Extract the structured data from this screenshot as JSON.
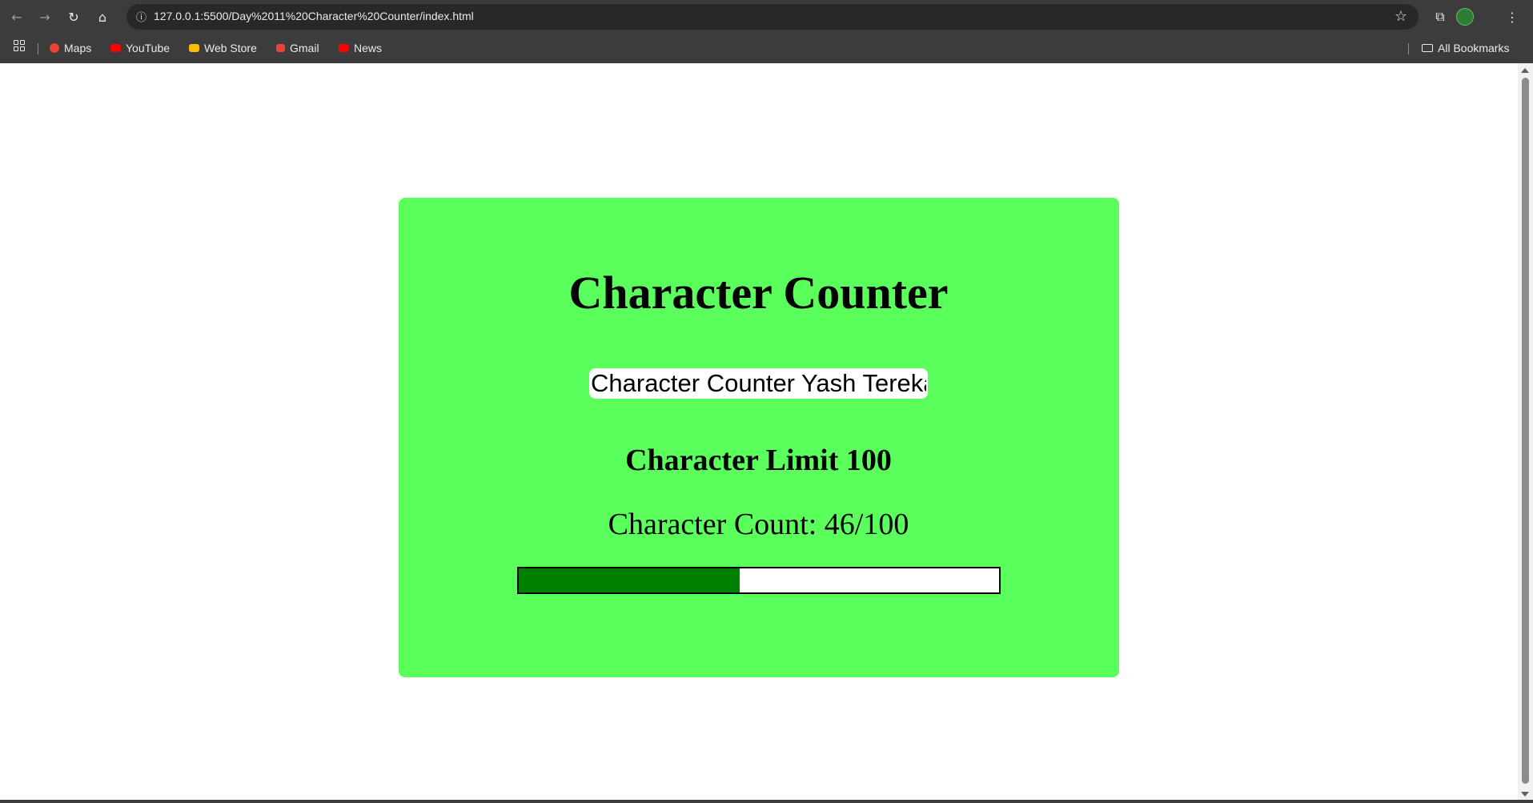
{
  "browser": {
    "url": "127.0.0.1:5500/Day%2011%20Character%20Counter/index.html",
    "bookmarks": [
      {
        "label": "Maps",
        "color": "#ea4335"
      },
      {
        "label": "YouTube",
        "color": "#ff0000"
      },
      {
        "label": "Web Store",
        "color": "#fbbc04"
      },
      {
        "label": "Gmail",
        "color": "#ea4335"
      },
      {
        "label": "News",
        "color": "#ff0000"
      }
    ],
    "all_bookmarks_label": "All Bookmarks",
    "icons": {
      "back": "back-arrow-icon",
      "forward": "forward-arrow-icon",
      "reload": "reload-icon",
      "home": "home-icon",
      "site_info": "site-info-icon",
      "star": "star-icon",
      "extensions": "extensions-icon",
      "profile": "profile-avatar",
      "menu": "kebab-menu-icon",
      "apps": "apps-grid-icon",
      "folder": "folder-icon"
    }
  },
  "page": {
    "title": "Character Counter",
    "input_value": "Character Counter Yash Terekar",
    "limit_label": "Character Limit 100",
    "count_label": "Character Count: 46/100",
    "count": 46,
    "limit": 100,
    "progress_fraction": 0.46,
    "colors": {
      "card_background": "#5aff5c",
      "progress_fill": "#008000",
      "progress_track": "#ffffff"
    }
  }
}
